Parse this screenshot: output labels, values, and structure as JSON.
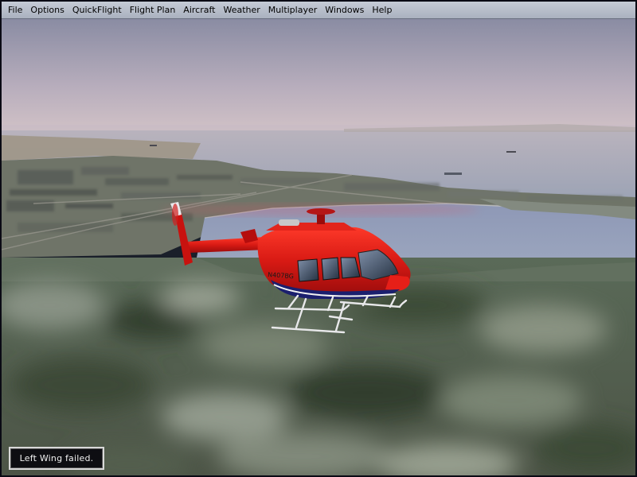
{
  "menubar": {
    "items": [
      "File",
      "Options",
      "QuickFlight",
      "Flight Plan",
      "Aircraft",
      "Weather",
      "Multiplayer",
      "Windows",
      "Help"
    ]
  },
  "aircraft": {
    "tail_number": "N407BG"
  },
  "status": {
    "message": "Left Wing failed."
  },
  "colors": {
    "menubar": "#b7bdc9",
    "helicopter_body": "#d41818",
    "sky_top": "#8d8fa6",
    "water": "#8f9db2"
  }
}
